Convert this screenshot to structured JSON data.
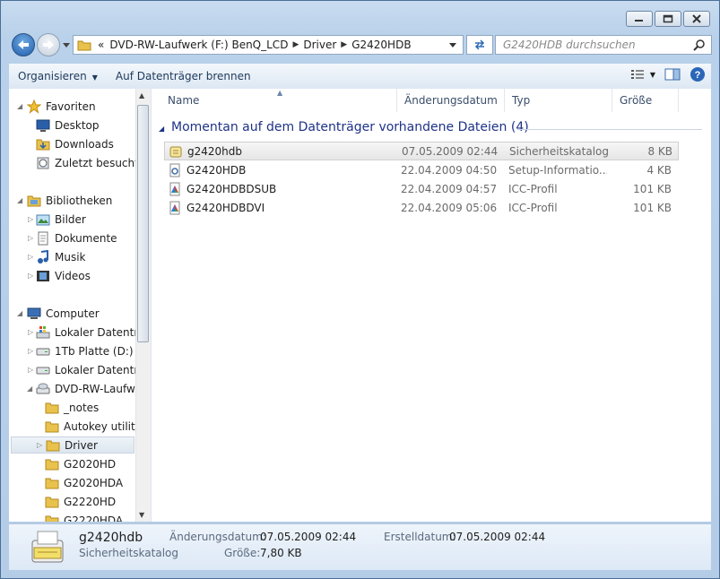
{
  "window": {
    "minimize": "minimize",
    "maximize": "maximize",
    "close": "close"
  },
  "address": {
    "overflow": "«",
    "crumbs": [
      "DVD-RW-Laufwerk (F:) BenQ_LCD",
      "Driver",
      "G2420HDB"
    ]
  },
  "search": {
    "placeholder": "G2420HDB durchsuchen"
  },
  "toolbar": {
    "organize": "Organisieren",
    "burn": "Auf Datenträger brennen"
  },
  "nav": {
    "favorites": "Favoriten",
    "desktop": "Desktop",
    "downloads": "Downloads",
    "recent": "Zuletzt besucht",
    "libraries": "Bibliotheken",
    "pictures": "Bilder",
    "documents": "Dokumente",
    "music": "Musik",
    "videos": "Videos",
    "computer": "Computer",
    "local1": "Lokaler Datenträger (C:)",
    "platte": "1Tb Platte (D:)",
    "local2": "Lokaler Datenträger (E:)",
    "dvd": "DVD-RW-Laufwerk (F:) BenQ_LCD",
    "notes": "_notes",
    "autokey": "Autokey utility",
    "driver": "Driver",
    "g2020hd": "G2020HD",
    "g2020hda": "G2020HDA",
    "g2220hd": "G2220HD",
    "g2220hda": "G2220HDA"
  },
  "columns": {
    "name": "Name",
    "date": "Änderungsdatum",
    "type": "Typ",
    "size": "Größe"
  },
  "group": "Momentan auf dem Datenträger vorhandene Dateien (4)",
  "files": [
    {
      "name": "g2420hdb",
      "date": "07.05.2009 02:44",
      "type": "Sicherheitskatalog",
      "size": "8 KB",
      "icon": "security-catalog-icon"
    },
    {
      "name": "G2420HDB",
      "date": "22.04.2009 04:50",
      "type": "Setup-Informatio...",
      "size": "4 KB",
      "icon": "setup-info-icon"
    },
    {
      "name": "G2420HDBDSUB",
      "date": "22.04.2009 04:57",
      "type": "ICC-Profil",
      "size": "101 KB",
      "icon": "icc-profile-icon"
    },
    {
      "name": "G2420HDBDVI",
      "date": "22.04.2009 05:06",
      "type": "ICC-Profil",
      "size": "101 KB",
      "icon": "icc-profile-icon"
    }
  ],
  "details": {
    "name": "g2420hdb",
    "type": "Sicherheitskatalog",
    "modified_label": "Änderungsdatum:",
    "modified_value": "07.05.2009 02:44",
    "created_label": "Erstelldatum:",
    "created_value": "07.05.2009 02:44",
    "size_label": "Größe:",
    "size_value": "7,80 KB"
  }
}
